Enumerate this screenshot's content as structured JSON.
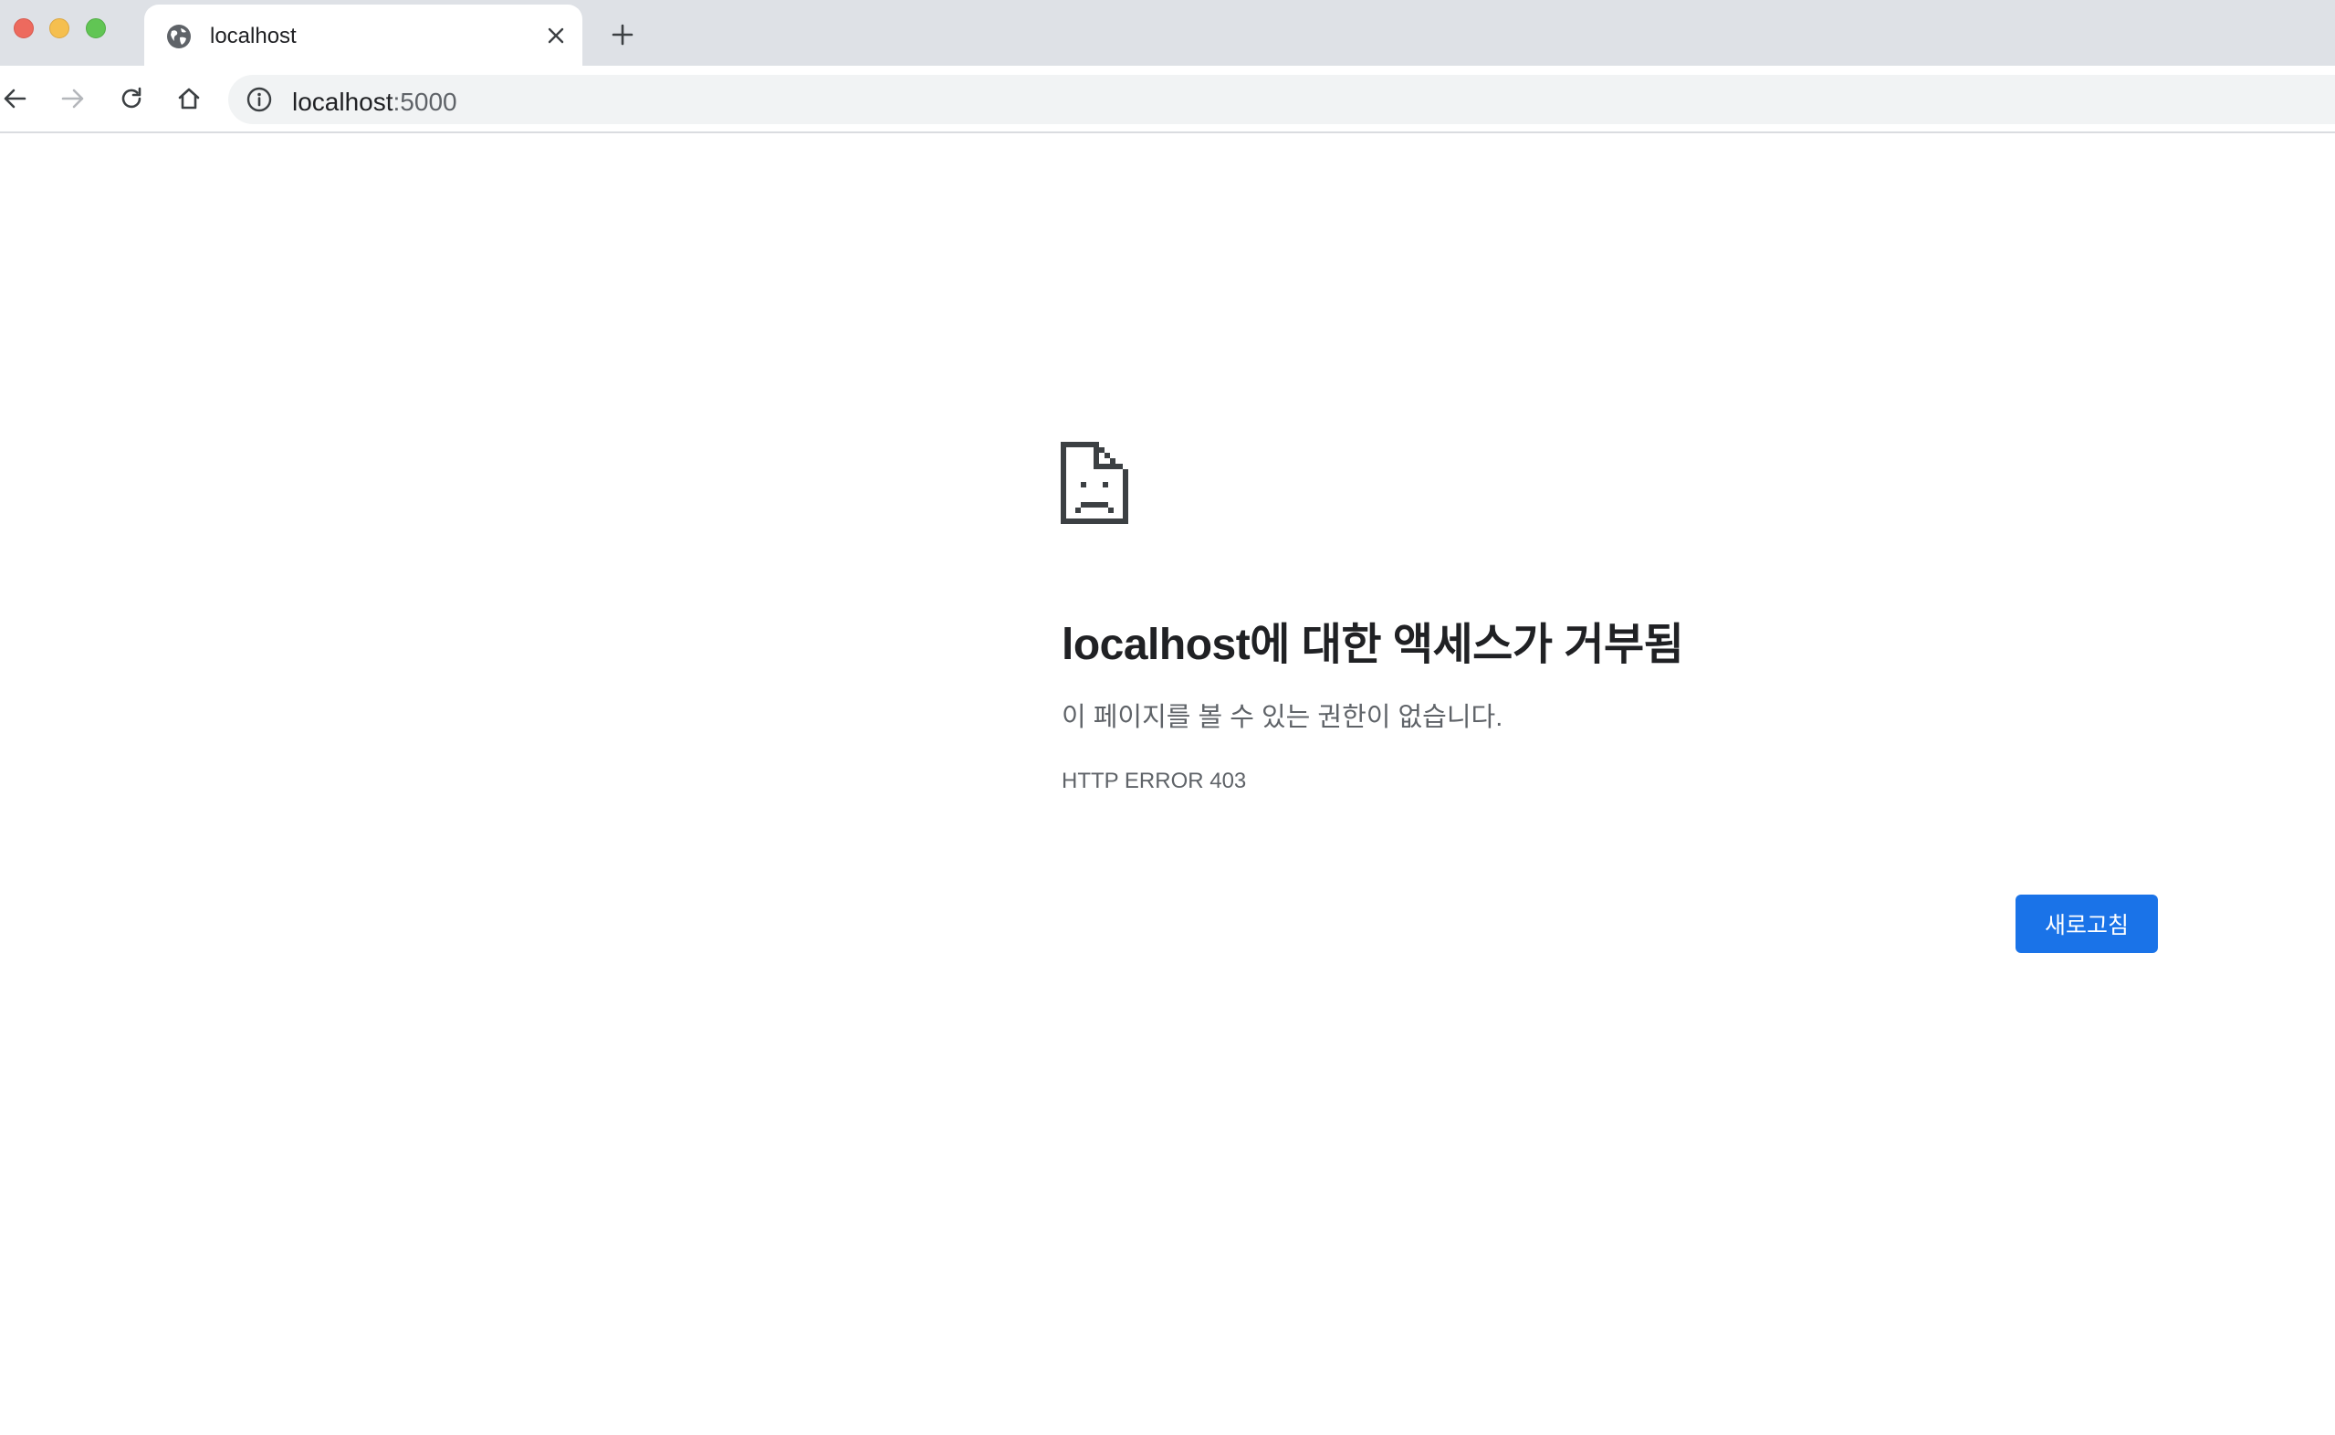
{
  "browser": {
    "tab": {
      "title": "localhost",
      "favicon": "globe-icon"
    },
    "address_bar": {
      "host": "localhost",
      "port": ":5000"
    }
  },
  "error_page": {
    "icon": "sad-file-icon",
    "title": "localhost에 대한 액세스가 거부됨",
    "description": "이 페이지를 볼 수 있는 권한이 없습니다.",
    "error_code": "HTTP ERROR 403",
    "reload_button": "새로고침"
  },
  "colors": {
    "accent": "#1a73e8",
    "tabstrip": "#dee1e6",
    "omnibox": "#f1f3f4",
    "text_primary": "#202124",
    "text_secondary": "#5f6368"
  }
}
